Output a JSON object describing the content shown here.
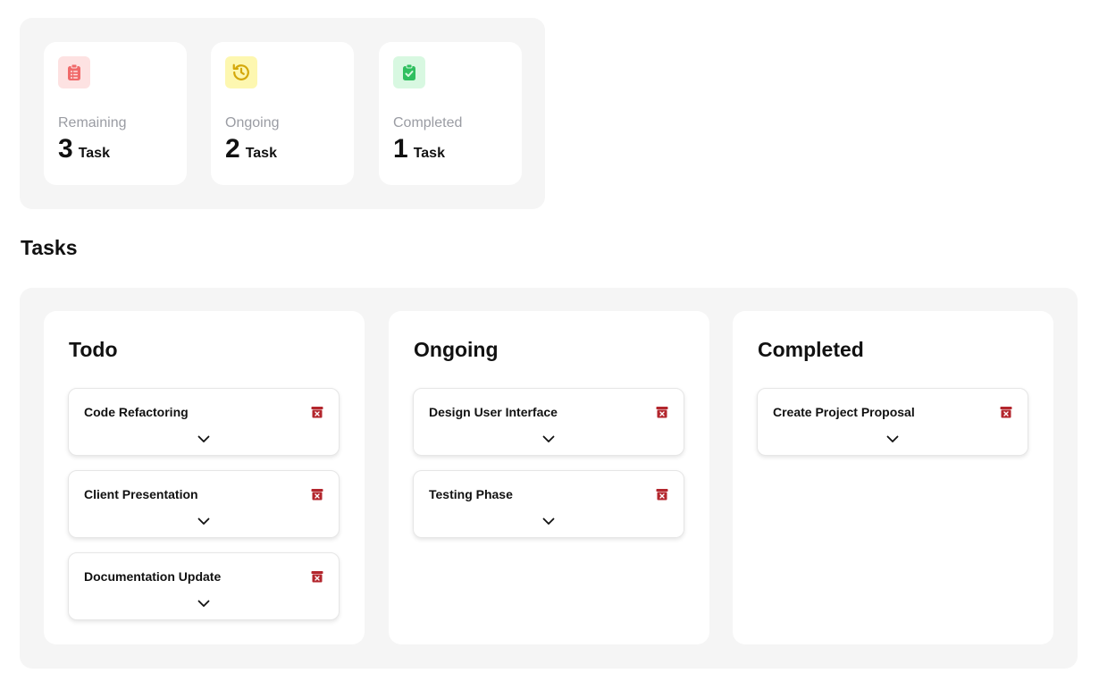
{
  "stats": [
    {
      "label": "Remaining",
      "count": "3",
      "unit": "Task",
      "icon": "clipboard-list-icon",
      "icon_color": "#f06a6a",
      "icon_bg": "#fde2e2"
    },
    {
      "label": "Ongoing",
      "count": "2",
      "unit": "Task",
      "icon": "history-icon",
      "icon_color": "#d4a80a",
      "icon_bg": "#fdf7b0"
    },
    {
      "label": "Completed",
      "count": "1",
      "unit": "Task",
      "icon": "clipboard-check-icon",
      "icon_color": "#2fbf5f",
      "icon_bg": "#d8f8e1"
    }
  ],
  "section_title": "Tasks",
  "columns": [
    {
      "title": "Todo",
      "tasks": [
        "Code Refactoring",
        "Client Presentation",
        "Documentation Update"
      ]
    },
    {
      "title": "Ongoing",
      "tasks": [
        "Design User Interface",
        "Testing Phase"
      ]
    },
    {
      "title": "Completed",
      "tasks": [
        "Create Project Proposal"
      ]
    }
  ],
  "colors": {
    "delete_icon": "#b3262d",
    "panel_bg": "#f5f5f5"
  },
  "task_icons": {
    "delete": "trash-icon",
    "expand": "chevron-down-icon"
  }
}
